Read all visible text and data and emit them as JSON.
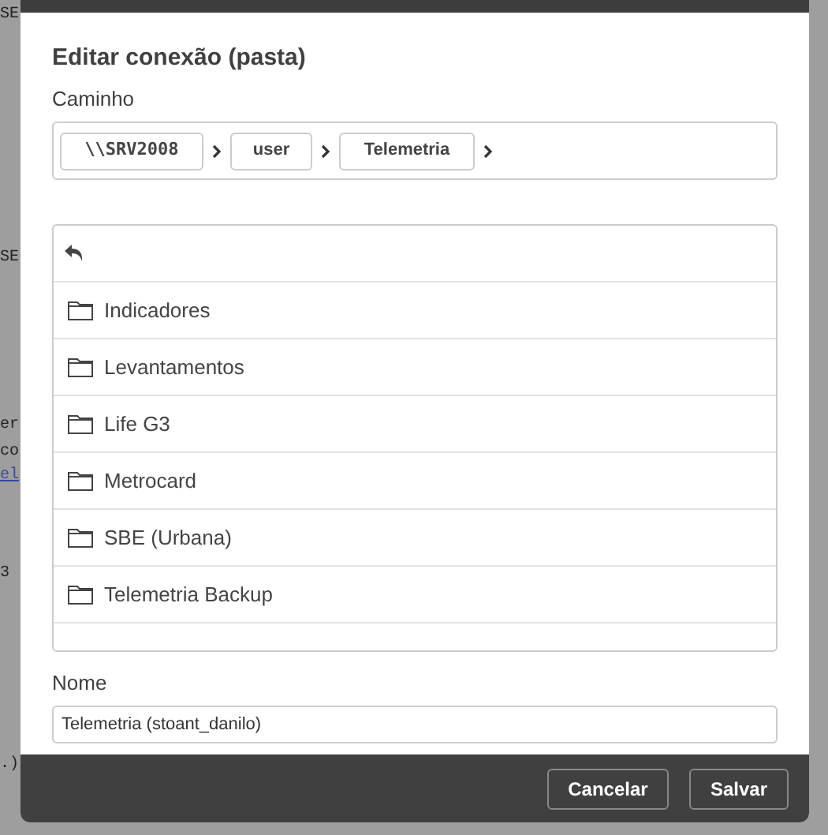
{
  "background_code": [
    "SE",
    "SE",
    "er",
    "co",
    "el",
    "3",
    ".)"
  ],
  "dialog": {
    "title": "Editar conexão (pasta)",
    "path": {
      "label": "Caminho",
      "segments": [
        "\\\\SRV2008",
        "user",
        "Telemetria"
      ]
    },
    "folders": [
      {
        "name": "Indicadores"
      },
      {
        "name": "Levantamentos"
      },
      {
        "name": "Life G3"
      },
      {
        "name": "Metrocard"
      },
      {
        "name": "SBE (Urbana)"
      },
      {
        "name": "Telemetria Backup"
      }
    ],
    "name_field": {
      "label": "Nome",
      "value": "Telemetria (stoant_danilo)"
    },
    "buttons": [
      "Cancelar",
      "Salvar"
    ]
  }
}
